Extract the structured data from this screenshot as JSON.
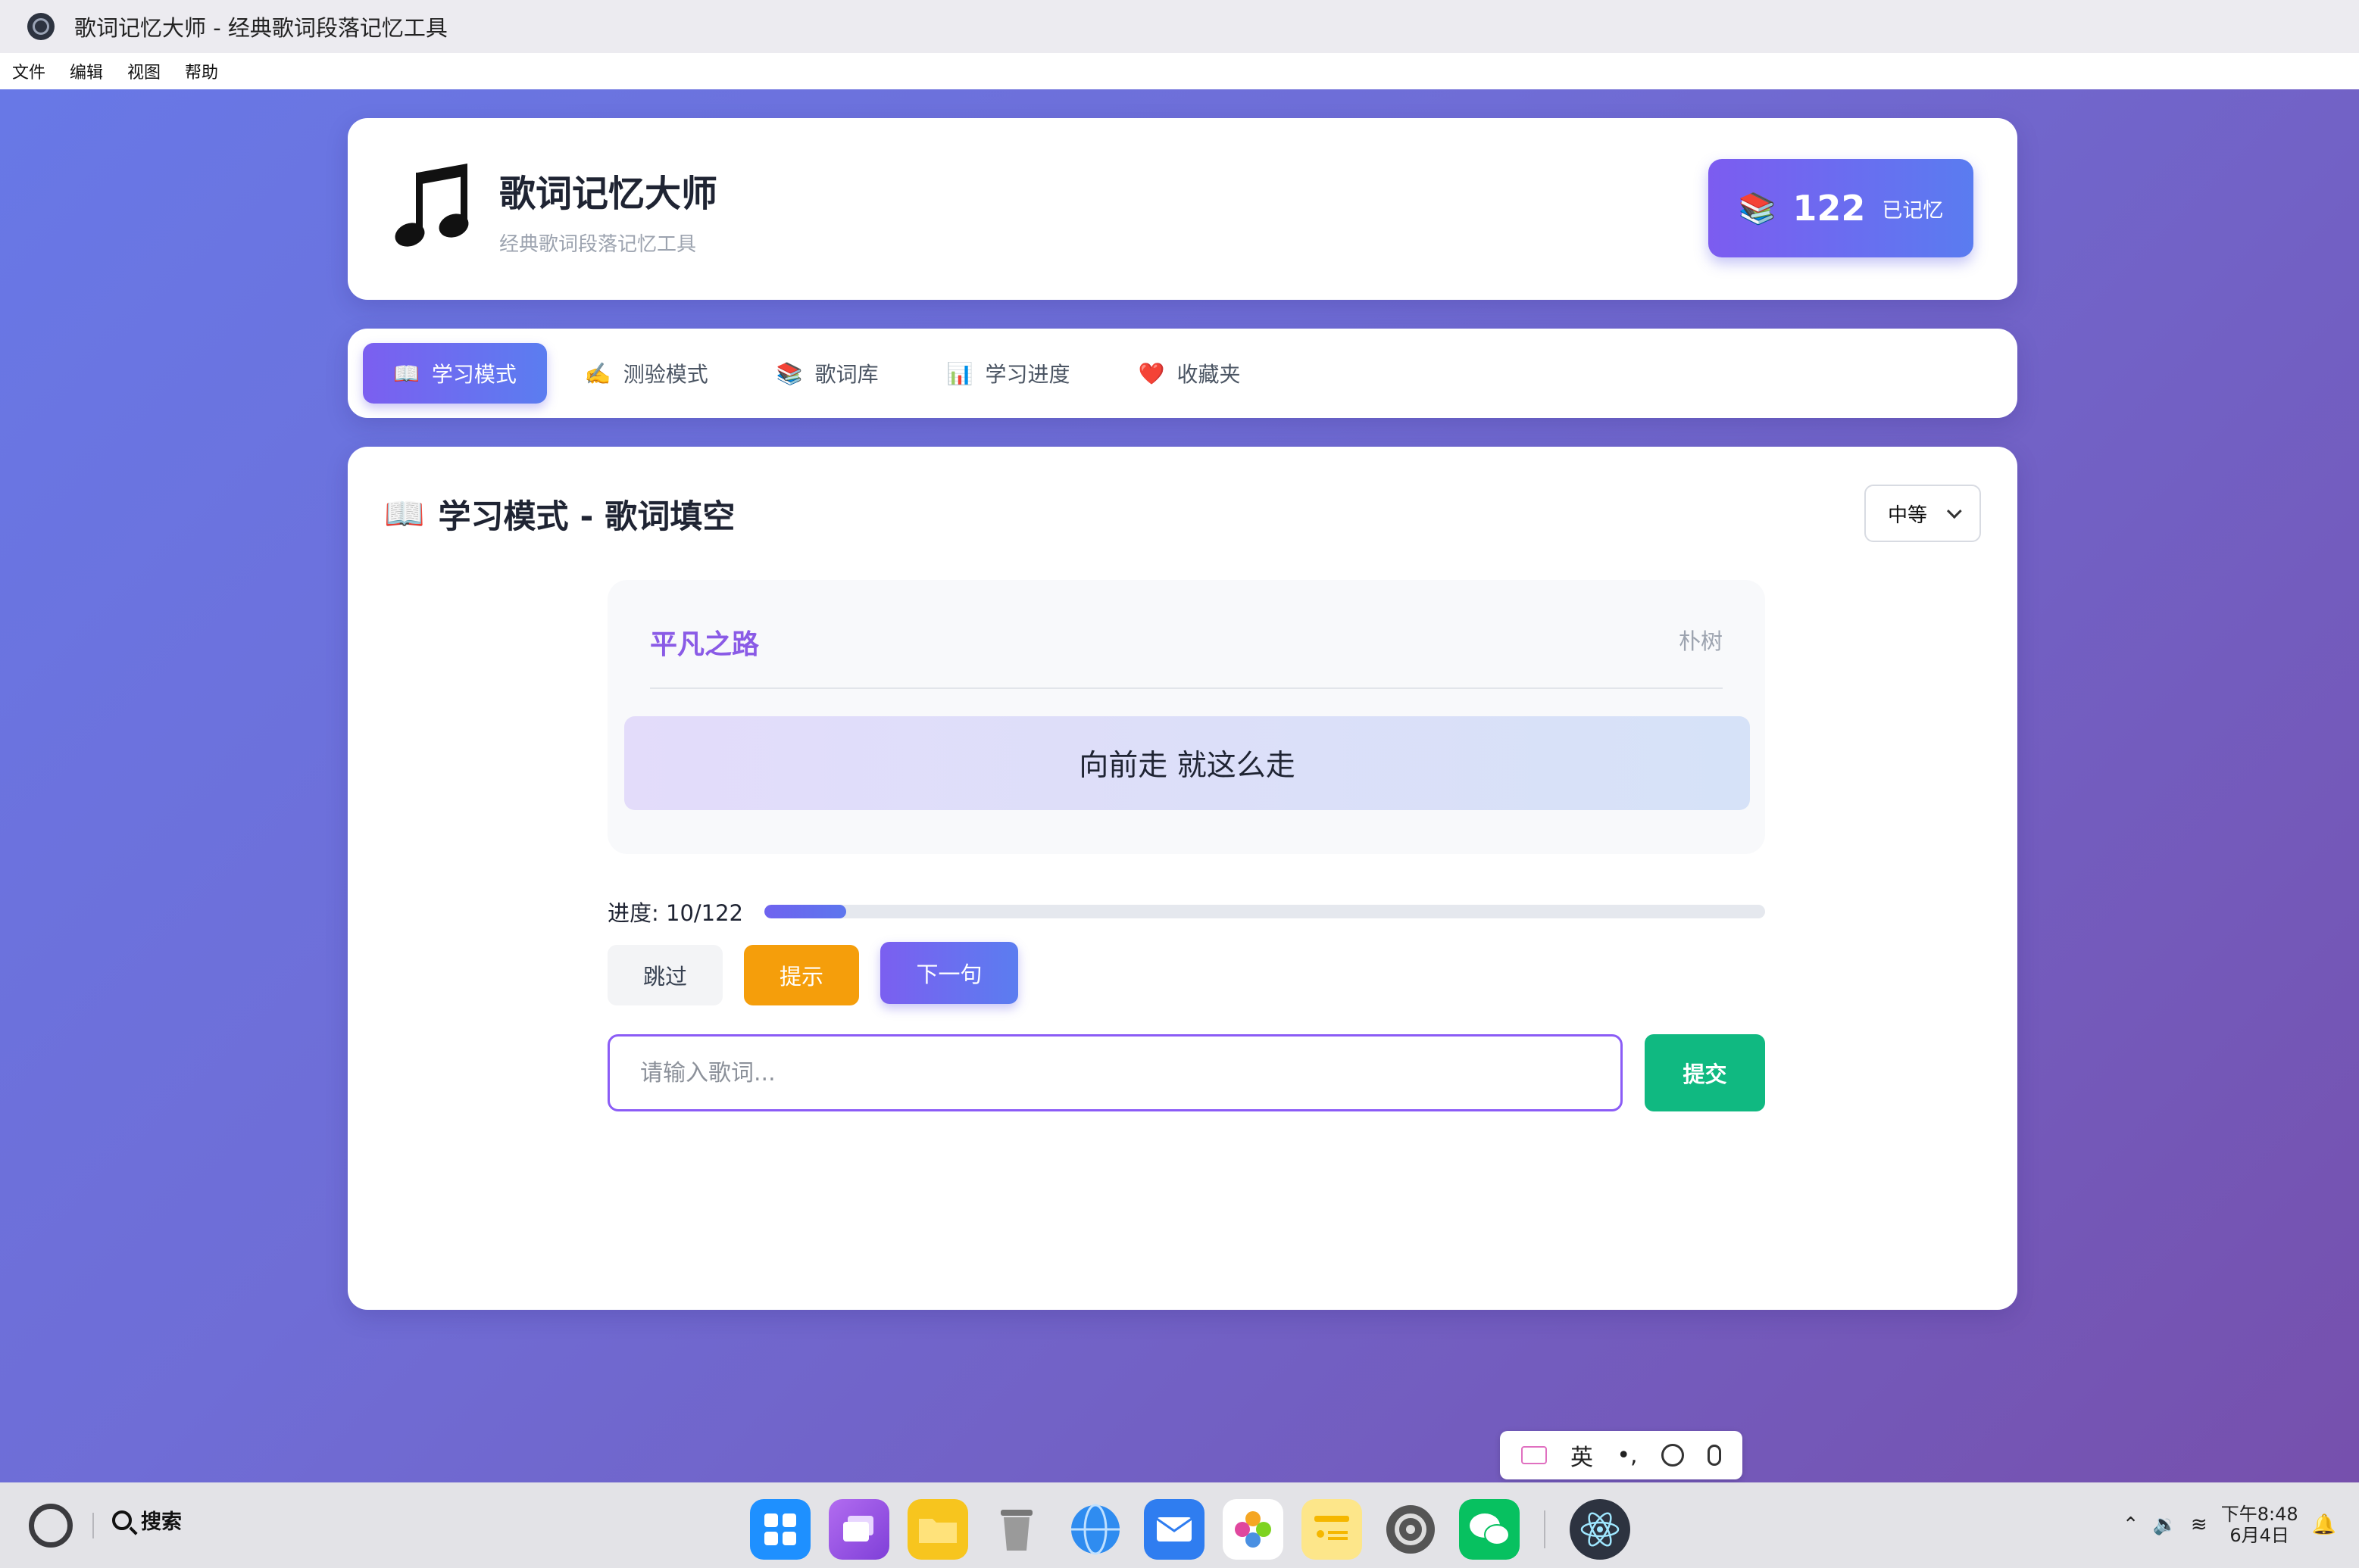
{
  "window": {
    "title": "歌词记忆大师 - 经典歌词段落记忆工具"
  },
  "menu": [
    "文件",
    "编辑",
    "视图",
    "帮助"
  ],
  "header": {
    "app_name": "歌词记忆大师",
    "subtitle": "经典歌词段落记忆工具",
    "icon": "music-note-icon",
    "stat_icon": "books-icon",
    "memorized_count": "122",
    "memorized_label": "已记忆"
  },
  "tabs": [
    {
      "icon": "📖",
      "icon_name": "book-icon",
      "label": "学习模式",
      "active": true
    },
    {
      "icon": "✍️",
      "icon_name": "writing-hand-icon",
      "label": "测验模式",
      "active": false
    },
    {
      "icon": "📚",
      "icon_name": "books-icon",
      "label": "歌词库",
      "active": false
    },
    {
      "icon": "📊",
      "icon_name": "bar-chart-icon",
      "label": "学习进度",
      "active": false
    },
    {
      "icon": "❤️",
      "icon_name": "heart-icon",
      "label": "收藏夹",
      "active": false
    }
  ],
  "study": {
    "title_icon": "📖",
    "title": "学习模式 - 歌词填空",
    "difficulty": "中等",
    "song_title": "平凡之路",
    "artist": "朴树",
    "lyric": "向前走 就这么走",
    "progress_label": "进度: 10/122",
    "progress_fraction": 0.082,
    "skip_label": "跳过",
    "hint_label": "提示",
    "next_label": "下一句",
    "input_placeholder": "请输入歌词...",
    "submit_label": "提交"
  },
  "ime": {
    "lang": "英",
    "punct": "•,"
  },
  "taskbar": {
    "search_label": "搜索",
    "clock_time": "下午8:48",
    "clock_date": "6月4日"
  },
  "colors": {
    "accent": "#7b5ff0",
    "accent2": "#5b7df0",
    "hint": "#f59e0b",
    "submit": "#10b981",
    "song_title": "#8a5be6"
  }
}
